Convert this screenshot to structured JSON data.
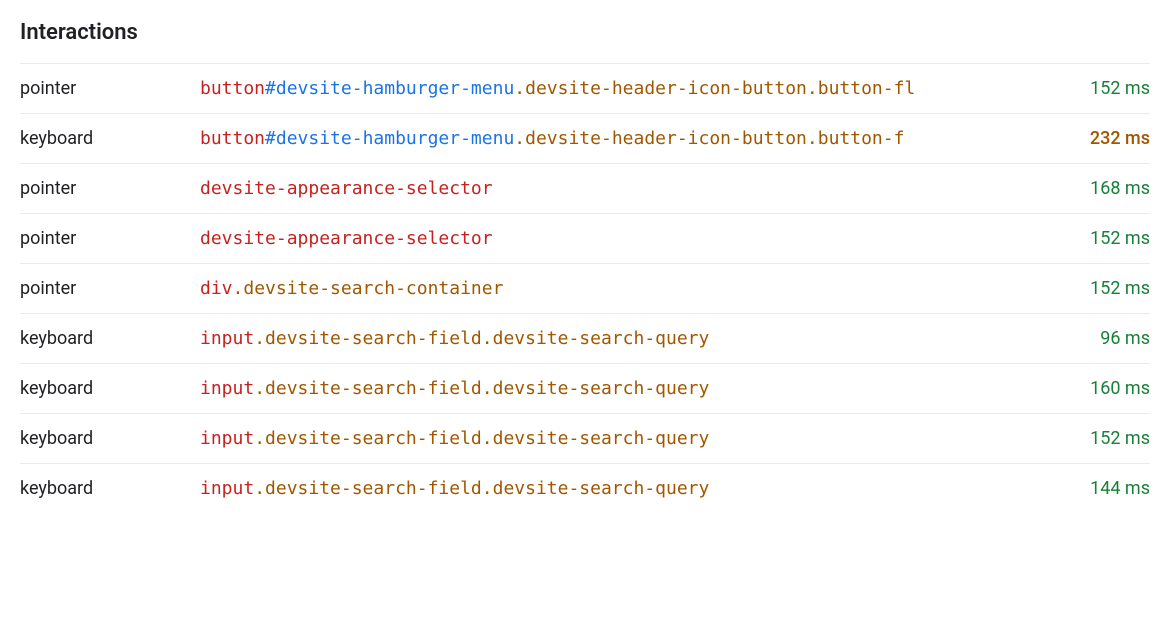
{
  "section_title": "Interactions",
  "rows": [
    {
      "type": "pointer",
      "selector_parts": [
        {
          "t": "tag",
          "v": "button"
        },
        {
          "t": "id",
          "v": "#devsite-hamburger-menu"
        },
        {
          "t": "class",
          "v": ".devsite-header-icon-button"
        },
        {
          "t": "class",
          "v": ".button-fl"
        }
      ],
      "duration": "152 ms",
      "duration_class": "fast"
    },
    {
      "type": "keyboard",
      "selector_parts": [
        {
          "t": "tag",
          "v": "button"
        },
        {
          "t": "id",
          "v": "#devsite-hamburger-menu"
        },
        {
          "t": "class",
          "v": ".devsite-header-icon-button"
        },
        {
          "t": "class",
          "v": ".button-f"
        }
      ],
      "duration": "232 ms",
      "duration_class": "medium"
    },
    {
      "type": "pointer",
      "selector_parts": [
        {
          "t": "tag",
          "v": "devsite-appearance-selector"
        }
      ],
      "duration": "168 ms",
      "duration_class": "fast"
    },
    {
      "type": "pointer",
      "selector_parts": [
        {
          "t": "tag",
          "v": "devsite-appearance-selector"
        }
      ],
      "duration": "152 ms",
      "duration_class": "fast"
    },
    {
      "type": "pointer",
      "selector_parts": [
        {
          "t": "tag",
          "v": "div"
        },
        {
          "t": "class",
          "v": ".devsite-search-container"
        }
      ],
      "duration": "152 ms",
      "duration_class": "fast"
    },
    {
      "type": "keyboard",
      "selector_parts": [
        {
          "t": "tag",
          "v": "input"
        },
        {
          "t": "class",
          "v": ".devsite-search-field"
        },
        {
          "t": "class",
          "v": ".devsite-search-query"
        }
      ],
      "duration": "96 ms",
      "duration_class": "fast"
    },
    {
      "type": "keyboard",
      "selector_parts": [
        {
          "t": "tag",
          "v": "input"
        },
        {
          "t": "class",
          "v": ".devsite-search-field"
        },
        {
          "t": "class",
          "v": ".devsite-search-query"
        }
      ],
      "duration": "160 ms",
      "duration_class": "fast"
    },
    {
      "type": "keyboard",
      "selector_parts": [
        {
          "t": "tag",
          "v": "input"
        },
        {
          "t": "class",
          "v": ".devsite-search-field"
        },
        {
          "t": "class",
          "v": ".devsite-search-query"
        }
      ],
      "duration": "152 ms",
      "duration_class": "fast"
    },
    {
      "type": "keyboard",
      "selector_parts": [
        {
          "t": "tag",
          "v": "input"
        },
        {
          "t": "class",
          "v": ".devsite-search-field"
        },
        {
          "t": "class",
          "v": ".devsite-search-query"
        }
      ],
      "duration": "144 ms",
      "duration_class": "fast"
    }
  ]
}
